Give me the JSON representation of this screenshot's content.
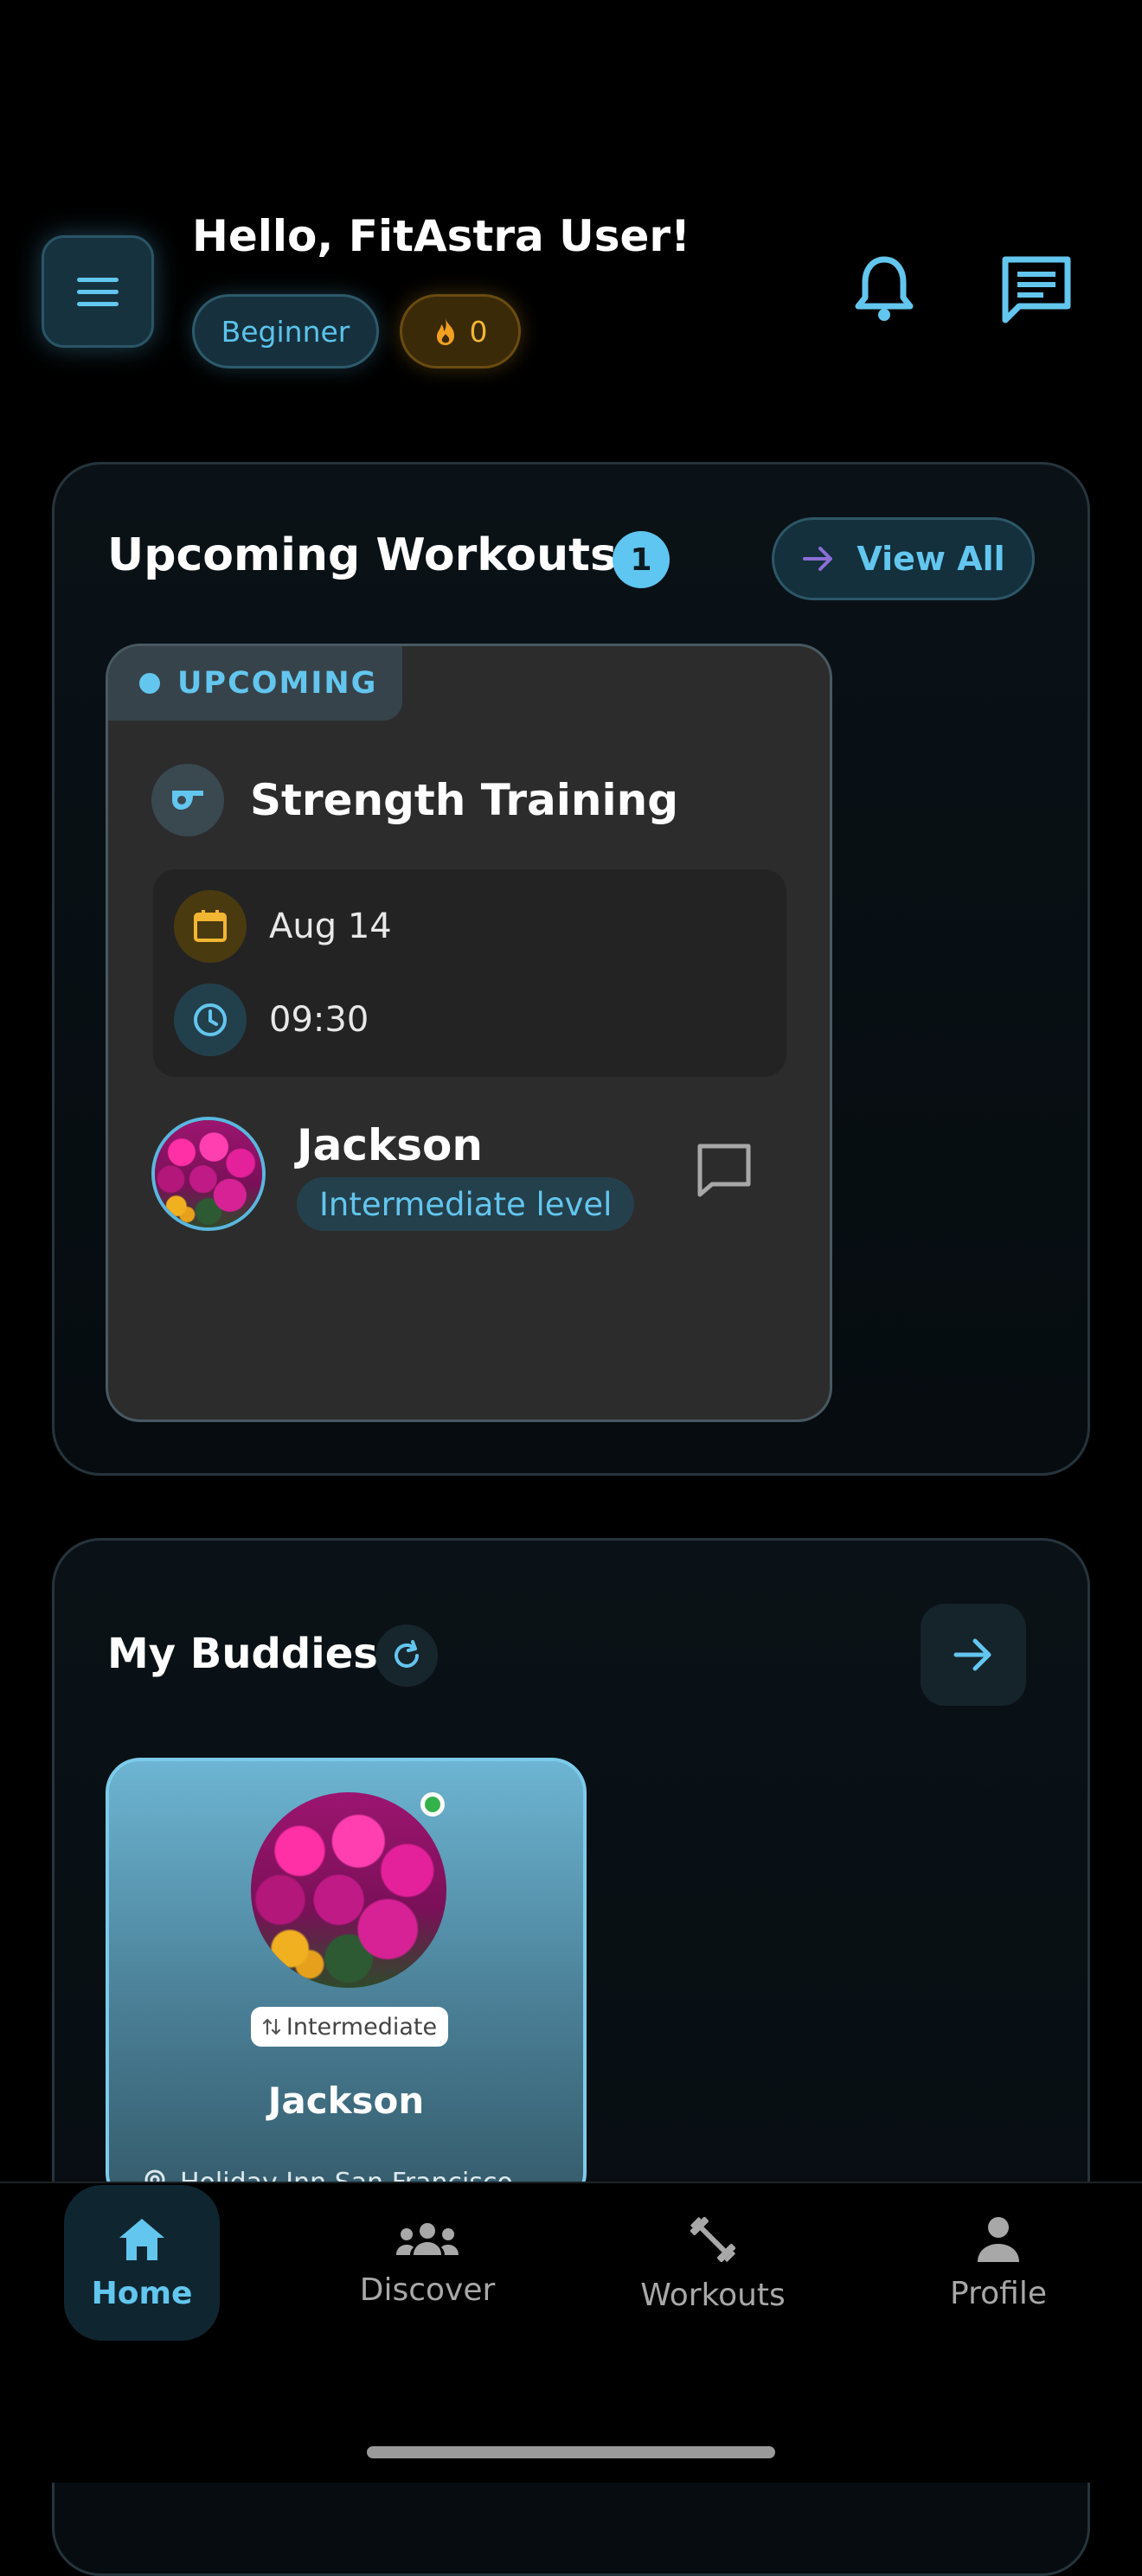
{
  "header": {
    "greeting": "Hello, FitAstra User!",
    "level_badge": "Beginner",
    "streak_count": "0"
  },
  "upcoming": {
    "title": "Upcoming Workouts",
    "count": "1",
    "view_all_label": "View All",
    "card": {
      "status": "UPCOMING",
      "workout_title": "Strength Training",
      "date": "Aug 14",
      "time": "09:30",
      "partner_name": "Jackson",
      "partner_level": "Intermediate level"
    }
  },
  "buddies": {
    "title": "My Buddies",
    "card": {
      "level": "Intermediate",
      "name": "Jackson",
      "location": "Holiday Inn San Francisco-..."
    }
  },
  "nav": {
    "home": "Home",
    "discover": "Discover",
    "workouts": "Workouts",
    "profile": "Profile"
  },
  "colors": {
    "accent": "#63c6ee",
    "streak": "#f2b632",
    "online": "#33b24a"
  }
}
